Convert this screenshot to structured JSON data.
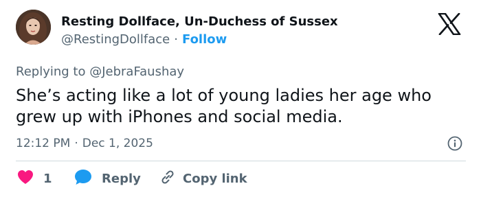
{
  "author": {
    "display_name": "Resting Dollface, Un-Duchess of Sussex",
    "handle": "@RestingDollface",
    "separator": "·",
    "follow_label": "Follow"
  },
  "tweet": {
    "reply_to": "Replying to @JebraFaushay",
    "text": "She’s acting like a lot of young ladies her age who grew up with iPhones and social media.",
    "time": "12:12 PM",
    "separator": "·",
    "date": "Dec 1, 2025"
  },
  "actions": {
    "like_count": "1",
    "reply_label": "Reply",
    "copy_label": "Copy link"
  },
  "colors": {
    "like": "#f91880",
    "reply": "#1d9bf0",
    "link": "#1d9bf0",
    "secondary_text": "#536471"
  },
  "icons": [
    "x-logo-icon",
    "info-icon",
    "heart-icon",
    "reply-bubble-icon",
    "link-icon"
  ]
}
